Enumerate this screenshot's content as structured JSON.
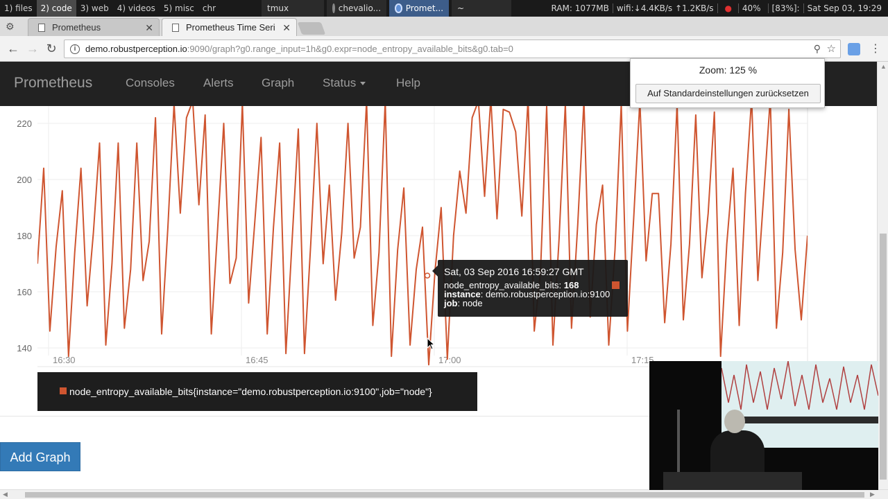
{
  "i3bar": {
    "workspaces": [
      "1) files",
      "2) code",
      "3) web",
      "4) videos",
      "5) misc",
      "chr"
    ],
    "windows": [
      "tmux",
      "chevalio...",
      "Promet...",
      "~"
    ],
    "status": [
      "RAM: 1077MB",
      "wifi:↓4.4KB/s ↑1.2KB/s",
      "40%",
      "[83%]:",
      "Sat Sep 03, 19:29"
    ]
  },
  "tabs": [
    {
      "title": "Prometheus"
    },
    {
      "title": "Prometheus Time Seri"
    }
  ],
  "address": {
    "host": "demo.robustperception.io",
    "rest": ":9090/graph?g0.range_input=1h&g0.expr=node_entropy_available_bits&g0.tab=0"
  },
  "nav": {
    "brand": "Prometheus",
    "links": [
      "Consoles",
      "Alerts",
      "Graph",
      "Status",
      "Help"
    ]
  },
  "zoom": {
    "label": "Zoom: 125 %",
    "reset": "Auf Standardeinstellungen zurücksetzen"
  },
  "chart_data": {
    "type": "line",
    "series": [
      {
        "name": "node_entropy_available_bits{instance=\"demo.robustperception.io:9100\",job=\"node\"}",
        "color": "#cf5530",
        "values": [
          170,
          204,
          146,
          176,
          196,
          137,
          174,
          204,
          155,
          181,
          213,
          141,
          170,
          213,
          147,
          168,
          213,
          164,
          178,
          222,
          145,
          183,
          227,
          188,
          222,
          228,
          191,
          223,
          145,
          182,
          220,
          163,
          172,
          227,
          156,
          185,
          215,
          145,
          183,
          213,
          138,
          178,
          218,
          138,
          177,
          220,
          170,
          198,
          157,
          181,
          220,
          172,
          183,
          228,
          148,
          174,
          228,
          137,
          175,
          197,
          141,
          168,
          183,
          134,
          167,
          190,
          136,
          180,
          203,
          188,
          222,
          228,
          194,
          229,
          186,
          225,
          224,
          217,
          187,
          229,
          146,
          167,
          226,
          141,
          179,
          227,
          147,
          184,
          228,
          151,
          184,
          198,
          141,
          175,
          227,
          146,
          186,
          228,
          171,
          195,
          195,
          149,
          177,
          227,
          150,
          177,
          223,
          165,
          188,
          224,
          137,
          177,
          204,
          148,
          195,
          229,
          164,
          196,
          229,
          147,
          174,
          225,
          175,
          150,
          180
        ]
      }
    ],
    "ylim": [
      136,
      229
    ],
    "yticks": [
      "140",
      "160",
      "180",
      "200",
      "220"
    ],
    "xticks": [
      "16:30",
      "16:45",
      "17:00",
      "17:15"
    ],
    "grid": true,
    "legend": "bottom"
  },
  "tooltip": {
    "date": "Sat, 03 Sep 2016 16:59:27 GMT",
    "metric": "node_entropy_available_bits:",
    "value": "168",
    "instance_label": "instance",
    "instance_value": ": demo.robustperception.io:9100",
    "job_label": "job",
    "job_value": ": node"
  },
  "legend": {
    "text": "node_entropy_available_bits{instance=\"demo.robustperception.io:9100\",job=\"node\"}"
  },
  "buttons": {
    "add_graph": "Add Graph"
  }
}
